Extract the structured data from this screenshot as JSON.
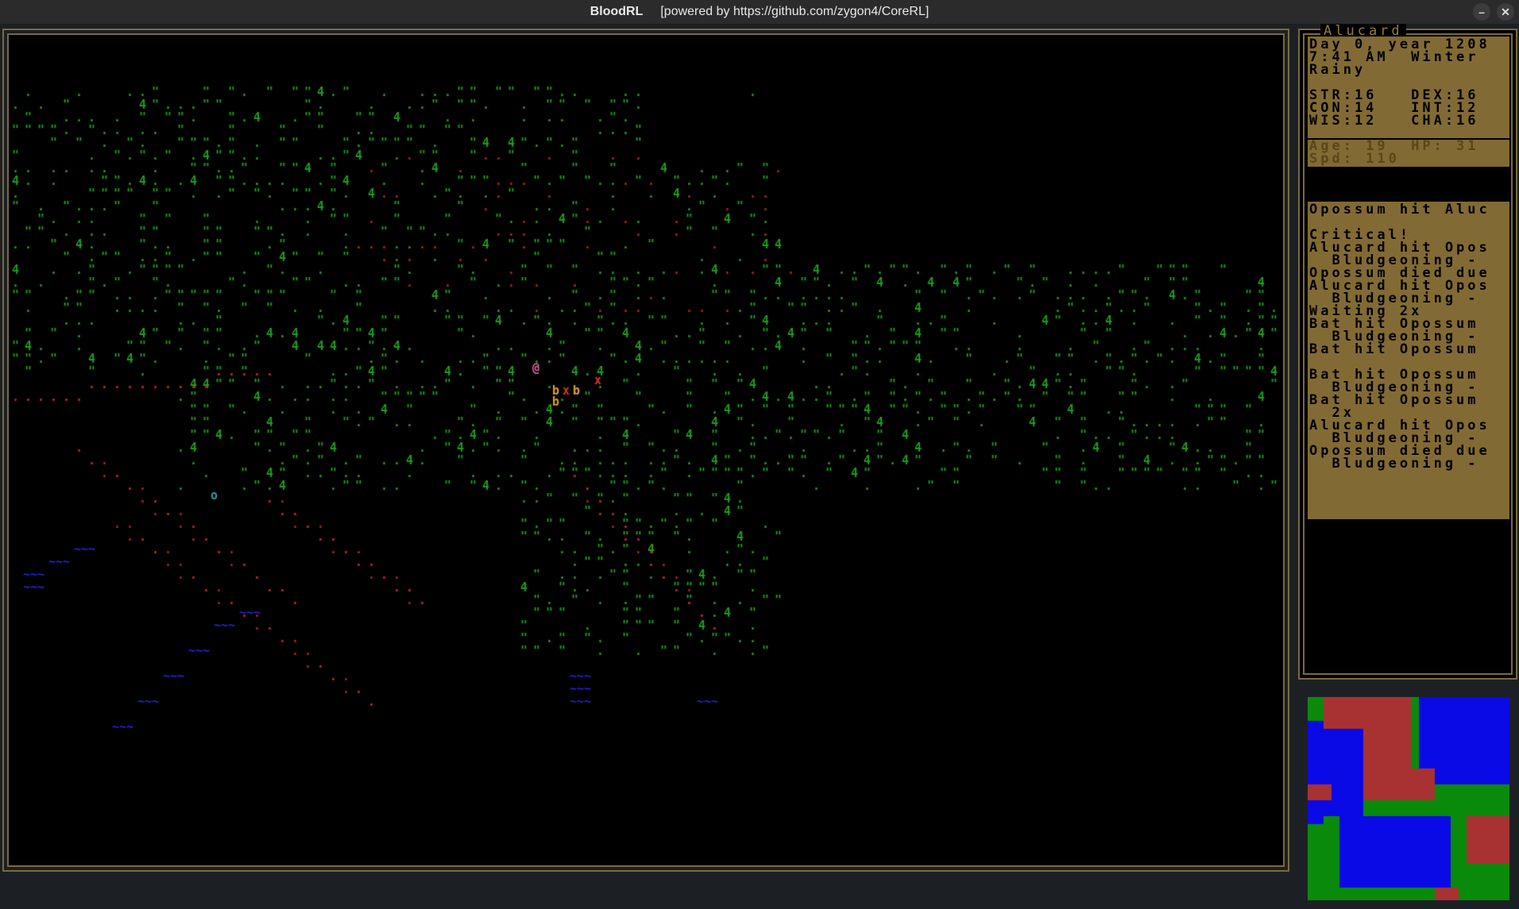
{
  "window": {
    "title": "BloodRL",
    "subtitle": "[powered by https://github.com/zygon4/CoreRL]",
    "controls": [
      "–",
      "✕"
    ]
  },
  "character": {
    "name": "Alucard",
    "date_line": "Day 0, year 1208",
    "time_line": "7:41 AM  Winter",
    "weather": "Rainy",
    "stats": [
      "STR:16   DEX:16",
      "CON:14   INT:12",
      "WIS:12   CHA:16"
    ],
    "vitals": [
      "Age: 19  HP: 31",
      "Spd: 110"
    ]
  },
  "log": [
    "Opossum hit Aluc",
    "",
    "Critical!",
    "Alucard hit Opos",
    "  Bludgeoning -",
    "Opossum died due",
    "Alucard hit Opos",
    "  Bludgeoning -",
    "Waiting 2x",
    "Bat hit Opossum",
    "  Bludgeoning -",
    "Bat hit Opossum",
    "",
    "Bat hit Opossum",
    "  Bludgeoning -",
    "Bat hit Opossum",
    "  2x",
    "Alucard hit Opos",
    "  Bludgeoning -",
    "Opossum died due",
    "  Bludgeoning -"
  ],
  "map": {
    "glyphs": {
      "grass": "\"",
      "ground": ".",
      "tree": "4",
      "water": "~",
      "player": "@",
      "bat": "b",
      "corpse": "x",
      "item": "o"
    },
    "colors": {
      "grass": "#1f9b1f",
      "path": "#b02222",
      "water": "#2222dd",
      "player": "#e06aa0",
      "bat": "#e0a030",
      "corpse": "#e03030",
      "item": "#3a9a9a"
    }
  },
  "minimap": {
    "colors": {
      "land": "#0a8a0a",
      "sea": "#0a0ae6",
      "settlement": "#a83232"
    }
  }
}
